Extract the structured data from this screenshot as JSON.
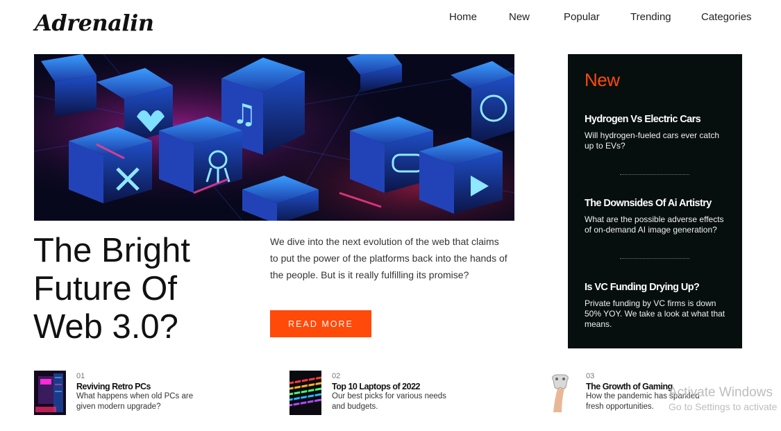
{
  "brand": {
    "logo": "Adrenalin"
  },
  "nav": {
    "items": [
      "Home",
      "New",
      "Popular",
      "Trending",
      "Categories"
    ]
  },
  "hero": {
    "headline": "The Bright Future Of Web 3.0?",
    "summary": "We dive into the next evolution of the web that claims to put the power of the platforms back into the hands of the people. But is it really fulfilling its promise?",
    "cta": "READ MORE"
  },
  "sidebar": {
    "title": "New",
    "items": [
      {
        "title": "Hydrogen Vs Electric Cars",
        "desc": "Will hydrogen-fueled cars ever catch up to EVs?"
      },
      {
        "title": "The Downsides Of Ai Artistry",
        "desc": "What are the possible adverse effects of on-demand AI image generation?"
      },
      {
        "title": "Is VC Funding Drying Up?",
        "desc": "Private funding by VC firms is down 50% YOY. We take a look at what that means."
      }
    ]
  },
  "bottom": {
    "items": [
      {
        "num": "01",
        "title": "Reviving Retro PCs",
        "desc": "What happens when old PCs are given modern upgrade?",
        "image": "retro-pc-thumb"
      },
      {
        "num": "02",
        "title": "Top 10 Laptops of 2022",
        "desc": "Our best picks for various needs and budgets.",
        "image": "keyboard-thumb"
      },
      {
        "num": "03",
        "title": "The Growth of Gaming",
        "desc": "How the pandemic has sparkled fresh opportunities.",
        "image": "controller-thumb"
      }
    ]
  },
  "watermark": {
    "line1": "Activate Windows",
    "line2": "Go to Settings to activate"
  },
  "colors": {
    "accent": "#ff4a0a",
    "sidebar_bg": "#070f0e"
  }
}
